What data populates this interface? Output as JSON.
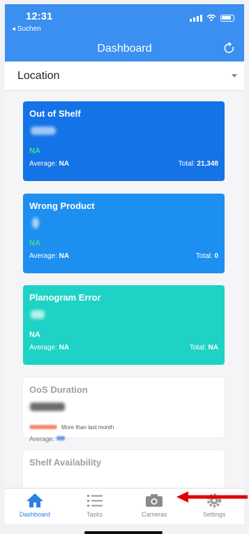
{
  "status": {
    "time": "12:31",
    "back": "◂ Suchen"
  },
  "header": {
    "title": "Dashboard"
  },
  "location": {
    "label": "Location"
  },
  "cards": [
    {
      "title": "Out of Shelf",
      "value": "NA",
      "avg_label": "Average:",
      "avg_value": "NA",
      "total_label": "Total:",
      "total_value": "21,348"
    },
    {
      "title": "Wrong Product",
      "value": "NA",
      "avg_label": "Average:",
      "avg_value": "NA",
      "total_label": "Total:",
      "total_value": "0"
    },
    {
      "title": "Planogram Error",
      "value": "NA",
      "avg_label": "Average:",
      "avg_value": "NA",
      "total_label": "Total:",
      "total_value": "NA"
    }
  ],
  "oos": {
    "title": "OoS Duration",
    "trend": "More than last month",
    "avg_label": "Average:"
  },
  "shelf": {
    "title": "Shelf Availability"
  },
  "tabs": [
    {
      "label": "Dashboard",
      "icon": "home-icon",
      "active": true
    },
    {
      "label": "Tasks",
      "icon": "list-icon",
      "active": false
    },
    {
      "label": "Cameras",
      "icon": "camera-icon",
      "active": false
    },
    {
      "label": "Settings",
      "icon": "gear-icon",
      "active": false
    }
  ],
  "colors": {
    "header": "#3b8ff0",
    "card1": "#1473e6",
    "card2": "#1d8ff0",
    "card3": "#1ed3c6",
    "tab_active": "#2d7fe0",
    "arrow": "#e00000"
  }
}
